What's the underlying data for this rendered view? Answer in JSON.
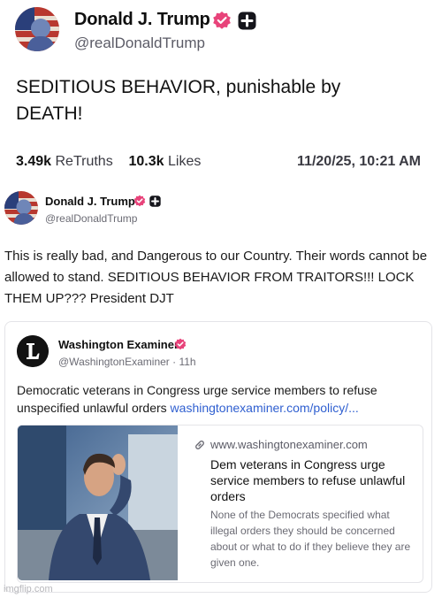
{
  "post": {
    "author_name": "Donald J. Trump",
    "handle": "@realDonaldTrump",
    "body": "SEDITIOUS BEHAVIOR, punishable by DEATH!",
    "retruths_count": "3.49k",
    "retruths_label": "ReTruths",
    "likes_count": "10.3k",
    "likes_label": "Likes",
    "timestamp": "11/20/25, 10:21 AM"
  },
  "inner_post": {
    "author_name": "Donald J. Trump",
    "handle": "@realDonaldTrump",
    "body": "This is really bad, and Dangerous to our Country. Their words cannot be allowed to stand. SEDITIOUS BEHAVIOR FROM TRAITORS!!! LOCK THEM UP??? President DJT"
  },
  "quoted": {
    "source_name": "Washington Examiner",
    "handle_time": "@WashingtonExaminer · 11h",
    "text": "Democratic veterans in Congress urge service members to refuse unspecified unlawful orders",
    "link_text": "washingtonexaminer.com/policy/...",
    "link_card": {
      "domain": "www.washingtonexaminer.com",
      "title": "Dem veterans in Congress urge service members to refuse unlawful orders",
      "description": "None of the Democrats specified what illegal orders they should be concerned about or what to do if they believe they are given one."
    }
  },
  "watermark": "imgflip.com",
  "icons": {
    "verified": "verified-badge-icon",
    "plus": "plus-badge-icon",
    "link": "link-icon",
    "logo": "washington-examiner-logo"
  },
  "colors": {
    "verified": "#e8437a",
    "link": "#2f5fd0",
    "muted": "#5b5b66"
  }
}
